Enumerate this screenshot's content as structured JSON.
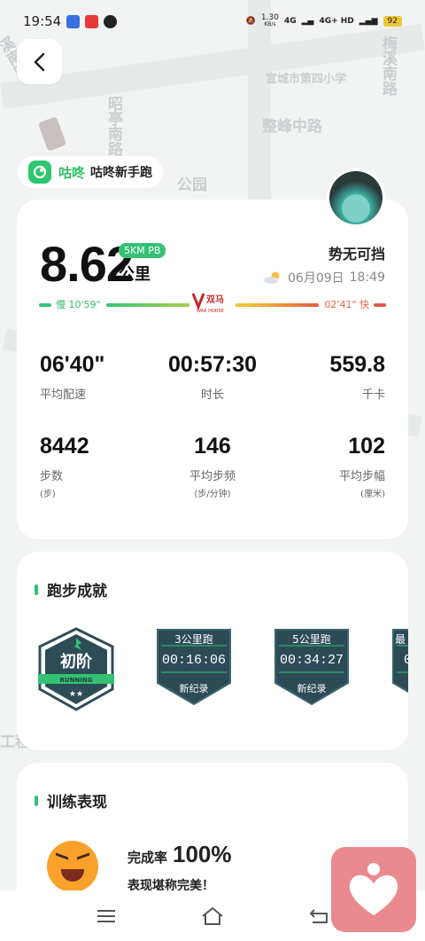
{
  "status_bar": {
    "time": "19:54",
    "net_speed_value": "1.30",
    "net_speed_unit": "KB/s",
    "signal1": "4G",
    "signal2": "4G+ HD",
    "battery": "92"
  },
  "map": {
    "labels": [
      "宣城市第四小学",
      "整峰中路",
      "昭亭南路",
      "梅溪南路",
      "公园",
      "工程",
      "溪南路"
    ]
  },
  "brand": {
    "name": "咕咚",
    "subtitle": "咕咚新手跑"
  },
  "run": {
    "distance": "8.62",
    "pb_badge": "5KM PB",
    "unit": "公里",
    "username": "势无可挡",
    "date": "06月09日",
    "time": "18:49",
    "pace_slow_label": "慢",
    "pace_slow_value": "10'59\"",
    "pace_fast_value": "02'41\"",
    "pace_fast_label": "快",
    "sponsor_logo_text": "WAR HORSE"
  },
  "stats": [
    {
      "value": "06'40\"",
      "label": "平均配速",
      "sub": ""
    },
    {
      "value": "00:57:30",
      "label": "时长",
      "sub": ""
    },
    {
      "value": "559.8",
      "label": "千卡",
      "sub": ""
    },
    {
      "value": "8442",
      "label": "步数",
      "sub": "(步)"
    },
    {
      "value": "146",
      "label": "平均步频",
      "sub": "(步/分钟)"
    },
    {
      "value": "102",
      "label": "平均步幅",
      "sub": "(厘米)"
    }
  ],
  "achievements": {
    "title": "跑步成就",
    "level": {
      "title": "初阶",
      "ribbon": "RUNNING",
      "stars": "★★"
    },
    "medals": [
      {
        "title": "3公里跑",
        "time": "00:16:06",
        "record": "新纪录"
      },
      {
        "title": "5公里跑",
        "time": "00:34:27",
        "record": "新纪录"
      },
      {
        "title": "最",
        "time": "0",
        "record": ""
      }
    ]
  },
  "training": {
    "title": "训练表现",
    "rate_label": "完成率",
    "rate_value": "100%",
    "description": "表现堪称完美！"
  },
  "colors": {
    "accent_green": "#35c174",
    "pace_fast": "#e8663e",
    "medal_dark": "#2c4b55",
    "float_button": "#ea8a8e"
  },
  "icons": {
    "back": "chevron-left-icon",
    "brand": "codoon-logo-icon",
    "weather": "partly-cloudy-icon",
    "float": "heart-health-icon",
    "nav_menu": "menu-icon",
    "nav_home": "home-icon",
    "nav_back": "return-icon"
  }
}
